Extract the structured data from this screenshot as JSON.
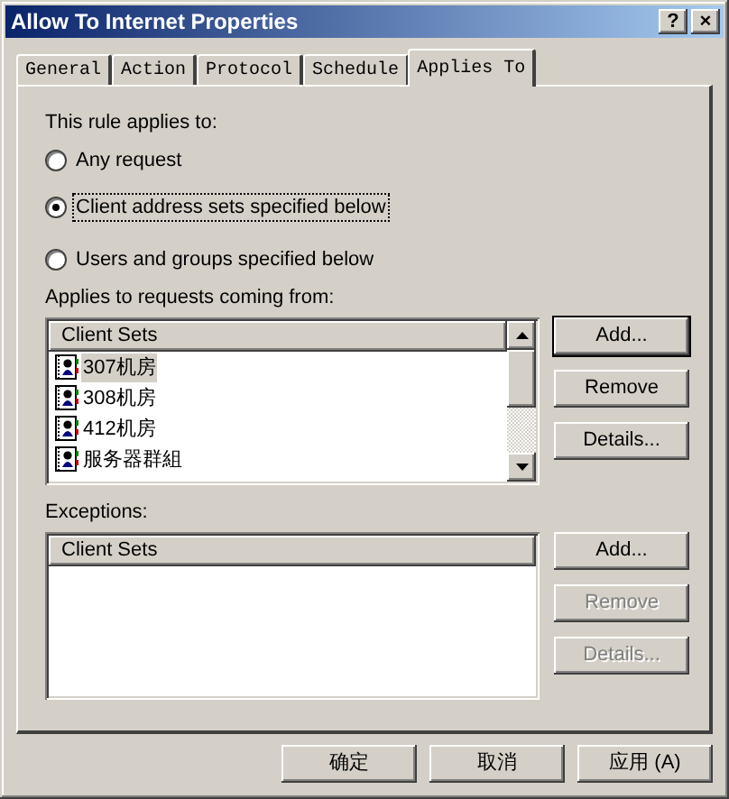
{
  "window": {
    "title": "Allow To Internet Properties",
    "title_buttons": [
      "?",
      "×"
    ]
  },
  "tabs": [
    {
      "label": "General",
      "selected": false
    },
    {
      "label": "Action",
      "selected": false
    },
    {
      "label": "Protocol",
      "selected": false
    },
    {
      "label": "Schedule",
      "selected": false
    },
    {
      "label": "Applies To",
      "selected": true
    }
  ],
  "rule_label": "This rule applies to:",
  "options": [
    {
      "label": "Any request",
      "selected": false
    },
    {
      "label": "Client address sets specified below",
      "selected": true
    },
    {
      "label": "Users and groups specified below",
      "selected": false
    }
  ],
  "sections": [
    {
      "label": "Applies to requests coming from:",
      "column": "Client Sets",
      "scrollbar": true,
      "rows": [
        {
          "name": "307机房",
          "selected": true
        },
        {
          "name": "308机房",
          "selected": false
        },
        {
          "name": "412机房",
          "selected": false
        },
        {
          "name": "服务器群組",
          "selected": false
        }
      ],
      "buttons": [
        {
          "label": "Add...",
          "default": true,
          "disabled": false
        },
        {
          "label": "Remove",
          "default": false,
          "disabled": false
        },
        {
          "label": "Details...",
          "default": false,
          "disabled": false
        }
      ]
    },
    {
      "label": "Exceptions:",
      "column": "Client Sets",
      "scrollbar": false,
      "buttons": [
        {
          "label": "Add...",
          "default": false,
          "disabled": false
        },
        {
          "label": "Remove",
          "default": false,
          "disabled": true
        },
        {
          "label": "Details...",
          "default": false,
          "disabled": true
        }
      ]
    }
  ],
  "footer_buttons": [
    "确定",
    "取消",
    "应用 (A)"
  ]
}
